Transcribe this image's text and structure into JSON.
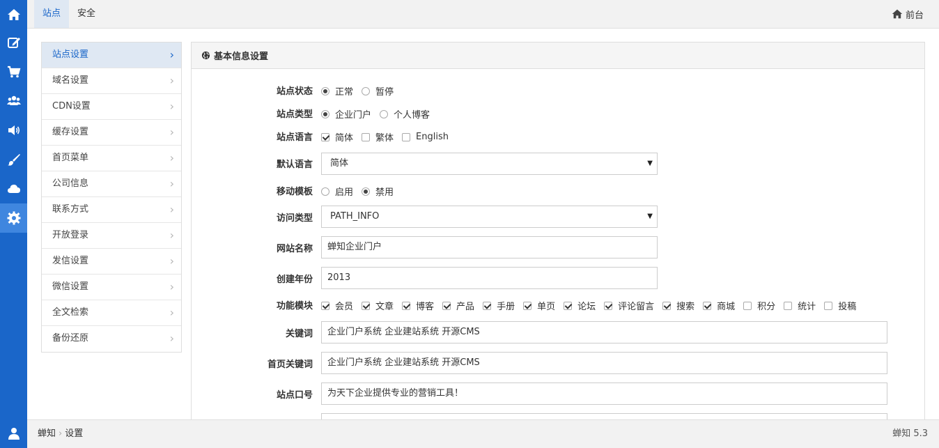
{
  "rail": {
    "items": [
      {
        "icon": "home-icon",
        "active": false
      },
      {
        "icon": "edit-icon",
        "active": false
      },
      {
        "icon": "cart-icon",
        "active": false
      },
      {
        "icon": "users-icon",
        "active": false
      },
      {
        "icon": "volume-icon",
        "active": false
      },
      {
        "icon": "brush-icon",
        "active": false
      },
      {
        "icon": "cloud-icon",
        "active": false
      },
      {
        "icon": "gear-icon",
        "active": true
      }
    ],
    "bottom_icon": "user-icon"
  },
  "topbar": {
    "tabs": [
      {
        "label": "站点",
        "active": true
      },
      {
        "label": "安全",
        "active": false
      }
    ],
    "frontend_label": "前台"
  },
  "menu": {
    "items": [
      "站点设置",
      "域名设置",
      "CDN设置",
      "缓存设置",
      "首页菜单",
      "公司信息",
      "联系方式",
      "开放登录",
      "发信设置",
      "微信设置",
      "全文检索",
      "备份还原"
    ],
    "active_index": 0
  },
  "panel": {
    "title": "基本信息设置",
    "site_status": {
      "label": "站点状态",
      "options": [
        "正常",
        "暂停"
      ],
      "selected": "正常"
    },
    "site_type": {
      "label": "站点类型",
      "options": [
        "企业门户",
        "个人博客"
      ],
      "selected": "企业门户"
    },
    "site_language": {
      "label": "站点语言",
      "options": [
        {
          "label": "简体",
          "checked": true
        },
        {
          "label": "繁体",
          "checked": false
        },
        {
          "label": "English",
          "checked": false
        }
      ]
    },
    "default_language": {
      "label": "默认语言",
      "value": "简体"
    },
    "mobile_template": {
      "label": "移动模板",
      "options": [
        "启用",
        "禁用"
      ],
      "selected": "禁用"
    },
    "access_type": {
      "label": "访问类型",
      "value": "PATH_INFO"
    },
    "site_name": {
      "label": "网站名称",
      "value": "蝉知企业门户"
    },
    "founded_year": {
      "label": "创建年份",
      "value": "2013"
    },
    "modules": {
      "label": "功能模块",
      "options": [
        {
          "label": "会员",
          "checked": true
        },
        {
          "label": "文章",
          "checked": true
        },
        {
          "label": "博客",
          "checked": true
        },
        {
          "label": "产品",
          "checked": true
        },
        {
          "label": "手册",
          "checked": true
        },
        {
          "label": "单页",
          "checked": true
        },
        {
          "label": "论坛",
          "checked": true
        },
        {
          "label": "评论留言",
          "checked": true
        },
        {
          "label": "搜索",
          "checked": true
        },
        {
          "label": "商城",
          "checked": true
        },
        {
          "label": "积分",
          "checked": false
        },
        {
          "label": "统计",
          "checked": false
        },
        {
          "label": "投稿",
          "checked": false
        }
      ]
    },
    "keywords": {
      "label": "关键词",
      "value": "企业门户系统 企业建站系统 开源CMS"
    },
    "home_keywords": {
      "label": "首页关键词",
      "value": "企业门户系统 企业建站系统 开源CMS"
    },
    "slogan": {
      "label": "站点口号",
      "value": "为天下企业提供专业的营销工具！"
    }
  },
  "footer": {
    "breadcrumb": [
      "蝉知",
      "设置"
    ],
    "separator": "›",
    "version": "蝉知 5.3"
  },
  "colors": {
    "brand": "#1a66c9",
    "rail_active": "#3f86df",
    "menu_active_bg": "#dfe8f3"
  }
}
